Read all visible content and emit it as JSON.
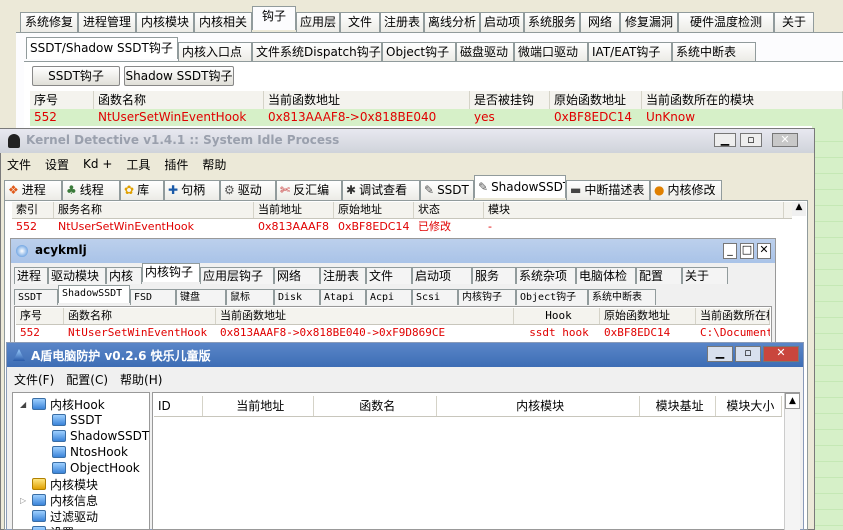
{
  "back_app": {
    "main_tabs": [
      "系统修复",
      "进程管理",
      "内核模块",
      "内核相关",
      "钩子",
      "应用层",
      "文件",
      "注册表",
      "离线分析",
      "启动项",
      "系统服务",
      "网络",
      "修复漏洞",
      "硬件温度检测",
      "关于"
    ],
    "active_main_tab": 4,
    "sub_tabs": [
      "SSDT/Shadow SSDT钩子",
      "内核入口点",
      "文件系统Dispatch钩子",
      "Object钩子",
      "磁盘驱动",
      "微端口驱动",
      "IAT/EAT钩子",
      "系统中断表"
    ],
    "buttons": {
      "ssdt": "SSDT钩子",
      "shadow": "Shadow SSDT钩子"
    },
    "columns": [
      "序号",
      "函数名称",
      "当前函数地址",
      "是否被挂钩",
      "原始函数地址",
      "当前函数所在的模块"
    ],
    "row": [
      "552",
      "NtUserSetWinEventHook",
      "0x813AAAF8->0x818BE040",
      "yes",
      "0xBF8EDC14",
      "UnKnow"
    ]
  },
  "kd_window": {
    "title": "Kernel Detective v1.4.1 :: System Idle Process",
    "menu": [
      "文件",
      "设置",
      "Kd +",
      "工具",
      "插件",
      "帮助"
    ],
    "tabs": [
      "进程",
      "线程",
      "库",
      "句柄",
      "驱动",
      "反汇编",
      "调试查看",
      "SSDT",
      "ShadowSSDT",
      "中断描述表",
      "内核修改"
    ],
    "tab_icons": [
      "windows-icon",
      "threads-icon",
      "library-icon",
      "handle-icon",
      "gear-icon",
      "disasm-icon",
      "debug-icon",
      "wrench-icon",
      "wrench-icon",
      "chip-icon",
      "warning-icon"
    ],
    "active_tab": 8,
    "columns": [
      "索引",
      "服务名称",
      "当前地址",
      "原始地址",
      "状态",
      "模块"
    ],
    "row": [
      "552",
      "NtUserSetWinEventHook",
      "0x813AAAF8",
      "0xBF8EDC14",
      "已修改",
      "-"
    ]
  },
  "acy_window": {
    "title": "acykmlj",
    "main_tabs": [
      "进程",
      "驱动模块",
      "内核",
      "内核钩子",
      "应用层钩子",
      "网络",
      "注册表",
      "文件",
      "启动项",
      "服务",
      "系统杂项",
      "电脑体检",
      "配置",
      "关于"
    ],
    "active_main_tab": 3,
    "sub_tabs": [
      "SSDT",
      "ShadowSSDT",
      "FSD",
      "键盘",
      "鼠标",
      "Disk",
      "Atapi",
      "Acpi",
      "Scsi",
      "内核钩子",
      "Object钩子",
      "系统中断表"
    ],
    "active_sub_tab": 1,
    "columns": [
      "序号",
      "函数名称",
      "当前函数地址",
      "Hook",
      "原始函数地址",
      "当前函数所在模块"
    ],
    "row": [
      "552",
      "NtUserSetWinEventHook",
      "0x813AAAF8->0x818BE040->0xF9D869CE",
      "ssdt hook",
      "0xBF8EDC14",
      "C:\\Documents"
    ]
  },
  "a_window": {
    "title": "A盾电脑防护 v0.2.6 快乐儿童版",
    "menu": [
      "文件(F)",
      "配置(C)",
      "帮助(H)"
    ],
    "tree": {
      "root": "内核Hook",
      "children": [
        "SSDT",
        "ShadowSSDT",
        "NtosHook",
        "ObjectHook"
      ],
      "others": [
        "内核模块",
        "内核信息",
        "过滤驱动",
        "设置"
      ]
    },
    "columns": [
      "ID",
      "当前地址",
      "函数名",
      "内核模块",
      "模块基址",
      "模块大小"
    ]
  },
  "colors": {
    "title_blue": "#0a246a",
    "highlight_green": "#d6f0c8",
    "hook_red": "#e00000"
  }
}
